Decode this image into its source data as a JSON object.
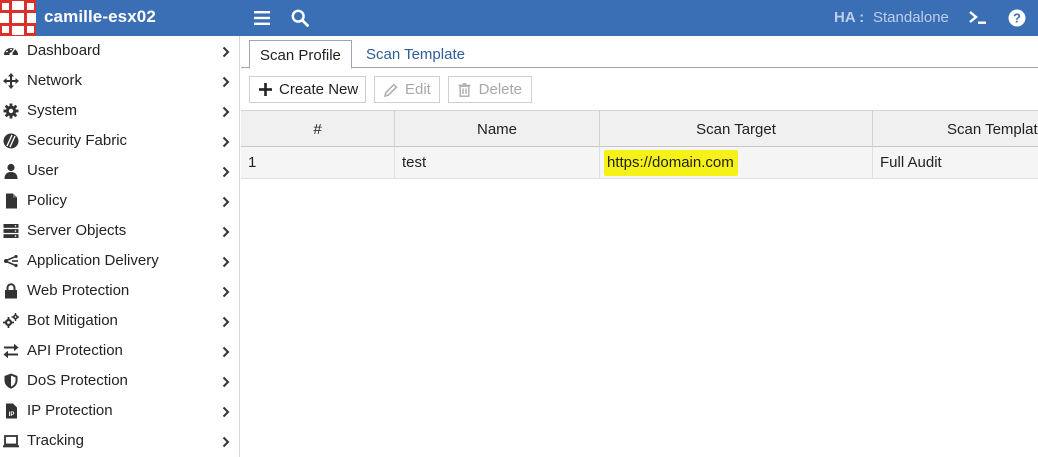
{
  "topbar": {
    "hostname": "camille-esx02",
    "menu_icon": "hamburger-menu-icon",
    "search_icon": "search-icon",
    "ha_label": "HA :",
    "ha_value": "Standalone",
    "cli_icon": "cli-terminal-icon",
    "help_icon": "help-icon"
  },
  "colors": {
    "topbar": "#3a6fb6",
    "logo": "#d9302c",
    "highlight": "#f6f218",
    "tab_link": "#2c5e98"
  },
  "sidebar": {
    "items": [
      {
        "label": "Dashboard",
        "icon": "dashboard-icon"
      },
      {
        "label": "Network",
        "icon": "network-icon"
      },
      {
        "label": "System",
        "icon": "gear-icon"
      },
      {
        "label": "Security Fabric",
        "icon": "security-fabric-icon"
      },
      {
        "label": "User",
        "icon": "user-icon"
      },
      {
        "label": "Policy",
        "icon": "policy-icon"
      },
      {
        "label": "Server Objects",
        "icon": "server-icon"
      },
      {
        "label": "Application Delivery",
        "icon": "application-delivery-icon"
      },
      {
        "label": "Web Protection",
        "icon": "lock-icon"
      },
      {
        "label": "Bot Mitigation",
        "icon": "gears-icon"
      },
      {
        "label": "API Protection",
        "icon": "exchange-arrows-icon"
      },
      {
        "label": "DoS Protection",
        "icon": "shield-icon"
      },
      {
        "label": "IP Protection",
        "icon": "ip-document-icon"
      },
      {
        "label": "Tracking",
        "icon": "laptop-icon"
      }
    ]
  },
  "tabs": [
    {
      "label": "Scan Profile",
      "active": true
    },
    {
      "label": "Scan Template",
      "active": false
    }
  ],
  "toolbar": {
    "create_label": "Create New",
    "edit_label": "Edit",
    "delete_label": "Delete"
  },
  "table": {
    "columns": [
      "#",
      "Name",
      "Scan Target",
      "Scan Template"
    ],
    "rows": [
      [
        "1",
        "test",
        "https://domain.com",
        "Full Audit"
      ]
    ]
  }
}
